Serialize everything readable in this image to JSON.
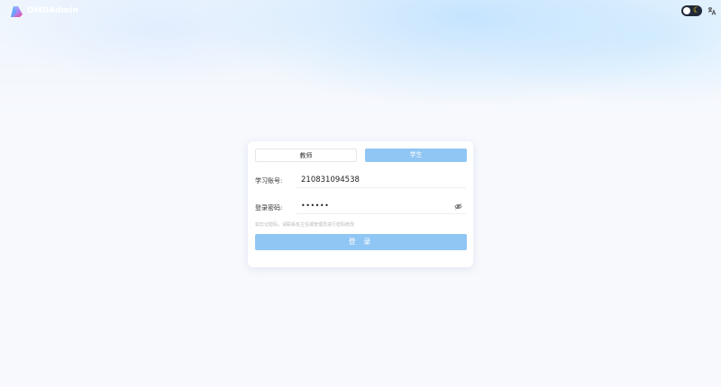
{
  "header": {
    "brand": "DMDAdmin",
    "theme_icon": "moon-icon",
    "lang_icon": "translate-icon"
  },
  "login": {
    "tabs": [
      {
        "label": "教师",
        "active": false
      },
      {
        "label": "学生",
        "active": true
      }
    ],
    "account_label": "学习账号:",
    "account_value": "210831094538",
    "password_label": "登录密码:",
    "password_value": "••••••",
    "hint": "如忘记密码，请联系班主任或管理员进行密码修改",
    "login_button": "登 录"
  },
  "colors": {
    "accent": "#90c6f4",
    "card_bg": "#ffffff",
    "hint_text": "#b4b8bf"
  }
}
